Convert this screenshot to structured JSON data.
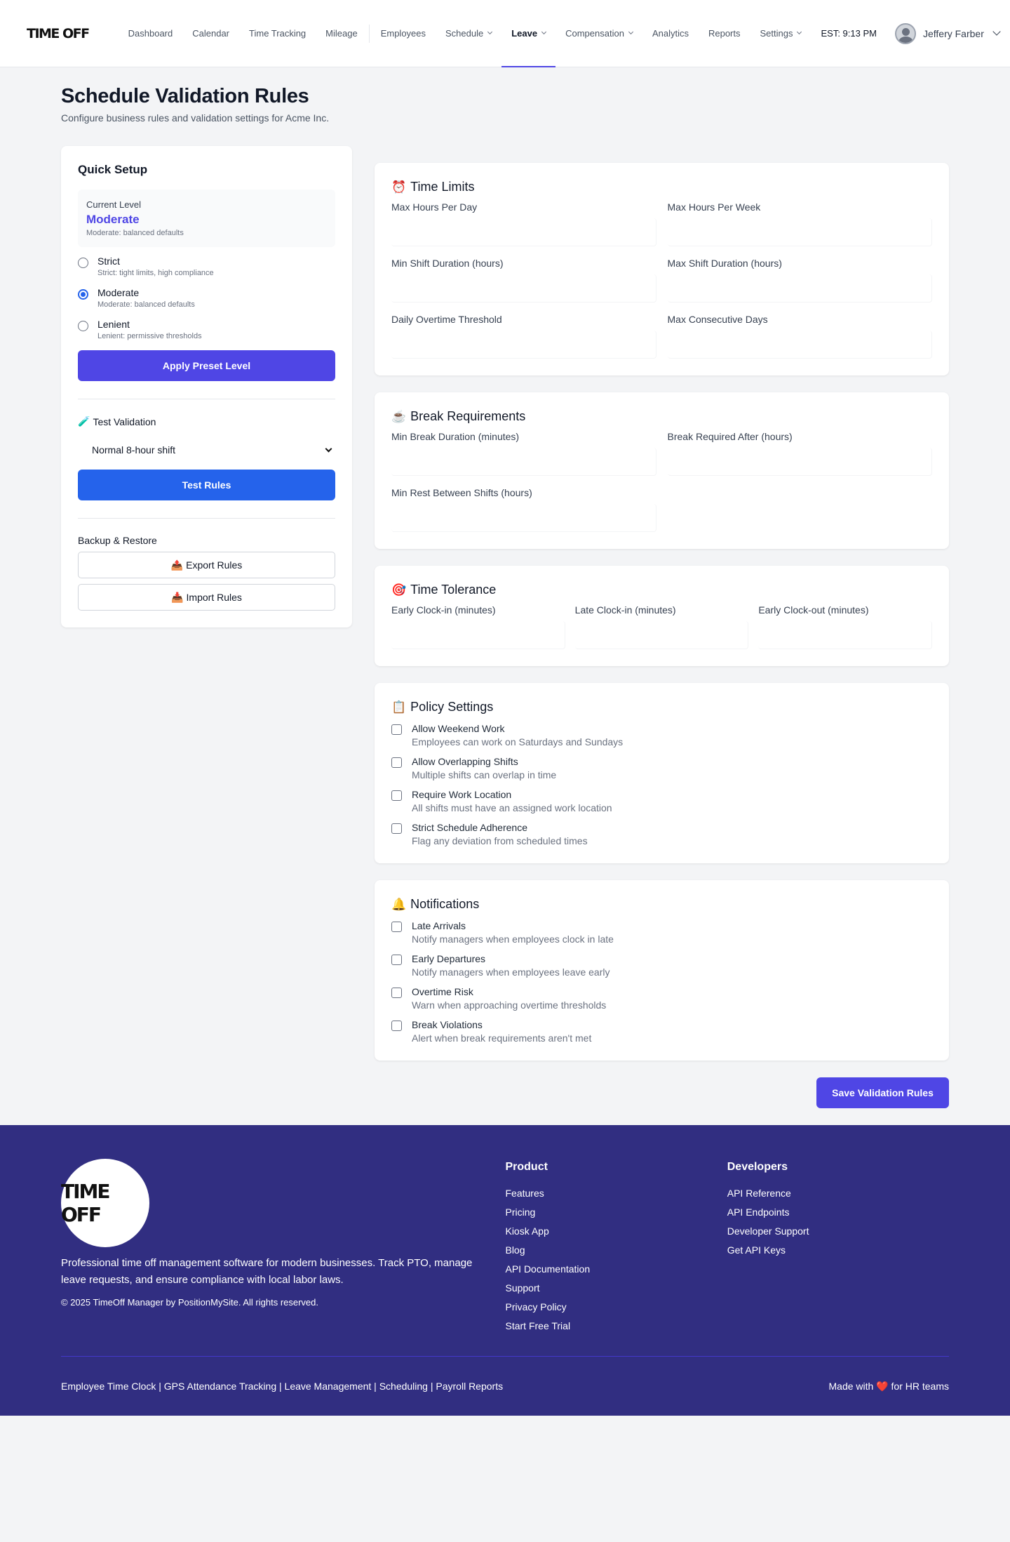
{
  "brand": {
    "logo": "TIME OFF"
  },
  "nav": {
    "items": [
      {
        "label": "Dashboard"
      },
      {
        "label": "Calendar"
      },
      {
        "label": "Time Tracking"
      },
      {
        "label": "Mileage"
      },
      {
        "label": "Employees"
      },
      {
        "label": "Schedule"
      },
      {
        "label": "Leave"
      },
      {
        "label": "Compensation"
      },
      {
        "label": "Analytics"
      },
      {
        "label": "Reports"
      },
      {
        "label": "Settings"
      }
    ],
    "active": "Leave",
    "clock": "EST: 9:13 PM",
    "user": "Jeffery Farber"
  },
  "page": {
    "title": "Schedule Validation Rules",
    "subtitle": "Configure business rules and validation settings for Acme Inc."
  },
  "quick_setup": {
    "title": "Quick Setup",
    "current_level_label": "Current Level",
    "current_level": "Moderate",
    "current_level_desc": "Moderate: balanced defaults",
    "options": [
      {
        "name": "Strict",
        "desc": "Strict: tight limits, high compliance",
        "checked": false
      },
      {
        "name": "Moderate",
        "desc": "Moderate: balanced defaults",
        "checked": true
      },
      {
        "name": "Lenient",
        "desc": "Lenient: permissive thresholds",
        "checked": false
      }
    ],
    "apply_label": "Apply Preset Level",
    "test_title": "Test Validation",
    "test_icon": "test-tube-icon",
    "test_selected": "Normal 8-hour shift",
    "test_button": "Test Rules",
    "backup_title": "Backup & Restore",
    "export_label": "Export Rules",
    "import_label": "Import Rules"
  },
  "time_limits": {
    "title": "Time Limits",
    "icon": "alarm-clock-icon",
    "fields": [
      "Max Hours Per Day",
      "Max Hours Per Week",
      "Min Shift Duration (hours)",
      "Max Shift Duration (hours)",
      "Daily Overtime Threshold",
      "Max Consecutive Days"
    ]
  },
  "breaks": {
    "title": "Break Requirements",
    "icon": "coffee-icon",
    "fields": [
      "Min Break Duration (minutes)",
      "Break Required After (hours)",
      "Min Rest Between Shifts (hours)"
    ]
  },
  "tolerance": {
    "title": "Time Tolerance",
    "icon": "target-icon",
    "fields": [
      "Early Clock-in (minutes)",
      "Late Clock-in (minutes)",
      "Early Clock-out (minutes)"
    ]
  },
  "policy": {
    "title": "Policy Settings",
    "icon": "clipboard-icon",
    "items": [
      {
        "name": "Allow Weekend Work",
        "desc": "Employees can work on Saturdays and Sundays"
      },
      {
        "name": "Allow Overlapping Shifts",
        "desc": "Multiple shifts can overlap in time"
      },
      {
        "name": "Require Work Location",
        "desc": "All shifts must have an assigned work location"
      },
      {
        "name": "Strict Schedule Adherence",
        "desc": "Flag any deviation from scheduled times"
      }
    ]
  },
  "notifications": {
    "title": "Notifications",
    "icon": "bell-icon",
    "items": [
      {
        "name": "Late Arrivals",
        "desc": "Notify managers when employees clock in late"
      },
      {
        "name": "Early Departures",
        "desc": "Notify managers when employees leave early"
      },
      {
        "name": "Overtime Risk",
        "desc": "Warn when approaching overtime thresholds"
      },
      {
        "name": "Break Violations",
        "desc": "Alert when break requirements aren't met"
      }
    ]
  },
  "save_label": "Save Validation Rules",
  "footer": {
    "logo": "TIME OFF",
    "blurb": "Professional time off management software for modern businesses. Track PTO, manage leave requests, and ensure compliance with local labor laws.",
    "copyright": "© 2025 TimeOff Manager by PositionMySite. All rights reserved.",
    "product_title": "Product",
    "product_links": [
      "Features",
      "Pricing",
      "Kiosk App",
      "Blog",
      "API Documentation",
      "Support",
      "Privacy Policy",
      "Start Free Trial"
    ],
    "dev_title": "Developers",
    "dev_links": [
      "API Reference",
      "API Endpoints",
      "Developer Support",
      "Get API Keys"
    ],
    "bottom_links": "Employee Time Clock | GPS Attendance Tracking | Leave Management | Scheduling | Payroll Reports",
    "made_with_prefix": "Made with",
    "made_with_suffix": "for HR teams",
    "heart_icon": "heart-icon"
  }
}
